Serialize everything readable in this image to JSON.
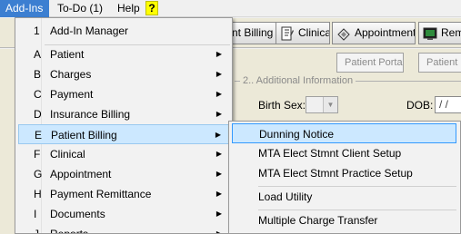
{
  "menubar": {
    "items": [
      {
        "label": "Add-Ins",
        "active": true
      },
      {
        "label": "To-Do (1)",
        "active": false
      },
      {
        "label": "Help",
        "active": false
      }
    ],
    "help_icon": "?"
  },
  "toolbar": {
    "buttons": [
      {
        "label": "nt Billing",
        "icon": "billing-icon"
      },
      {
        "label": "Clinical",
        "icon": "clinical-icon"
      },
      {
        "label": "Appointment",
        "icon": "appointment-icon"
      },
      {
        "label": "Rem",
        "icon": "reminder-icon"
      }
    ]
  },
  "form": {
    "patient_portal": "Patient Portal",
    "patient_button_2": "Patient F",
    "group_title": "2.. Additional Information",
    "birth_sex_label": "Birth Sex:",
    "dob_label": "DOB:",
    "dob_value": "/ /"
  },
  "addins_menu": {
    "items": [
      {
        "accel": "1",
        "label": "Add-In Manager",
        "submenu": false
      },
      {
        "accel": "A",
        "label": "Patient",
        "submenu": true
      },
      {
        "accel": "B",
        "label": "Charges",
        "submenu": true
      },
      {
        "accel": "C",
        "label": "Payment",
        "submenu": true
      },
      {
        "accel": "D",
        "label": "Insurance Billing",
        "submenu": true
      },
      {
        "accel": "E",
        "label": "Patient Billing",
        "submenu": true,
        "highlighted": true
      },
      {
        "accel": "F",
        "label": "Clinical",
        "submenu": true
      },
      {
        "accel": "G",
        "label": "Appointment",
        "submenu": true
      },
      {
        "accel": "H",
        "label": "Payment Remittance",
        "submenu": true
      },
      {
        "accel": "I",
        "label": "Documents",
        "submenu": true
      },
      {
        "accel": "J",
        "label": "Reports",
        "submenu": true
      }
    ]
  },
  "patient_billing_submenu": {
    "items": [
      {
        "label": "Dunning Notice",
        "highlighted": true
      },
      {
        "label": "MTA Elect Stmnt Client Setup"
      },
      {
        "label": "MTA Elect Stmnt Practice Setup"
      },
      {
        "label": "Load Utility"
      },
      {
        "label": "Multiple Charge Transfer"
      }
    ]
  },
  "colors": {
    "menubar_active": "#3c7fd1",
    "menu_highlight": "#cce8ff",
    "submenu_highlight_border": "#3399ff",
    "help_icon_bg": "#ffff00"
  }
}
